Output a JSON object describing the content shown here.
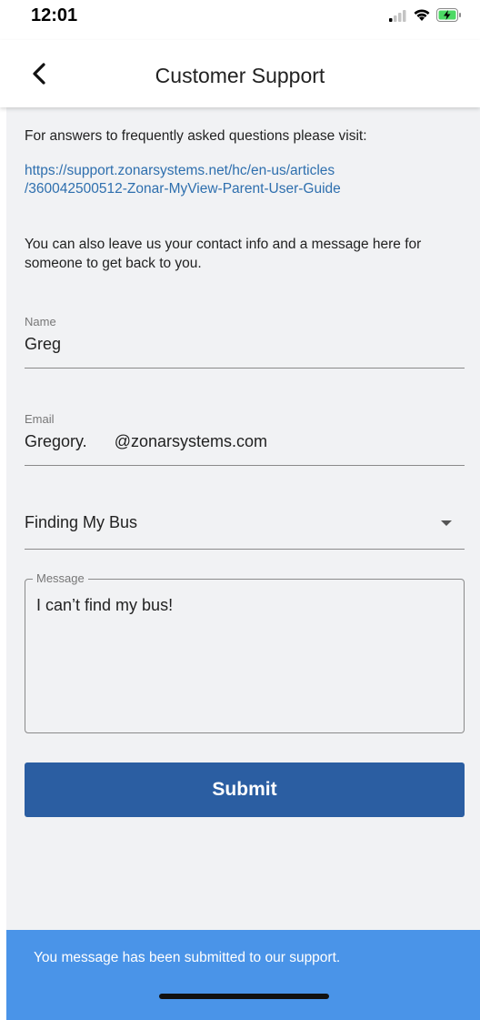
{
  "status_bar": {
    "time": "12:01",
    "icons": [
      "signal-icon",
      "wifi-icon",
      "battery-charging-icon"
    ],
    "battery_color": "#4cd964"
  },
  "header": {
    "title": "Customer Support",
    "back_icon": "chevron-left-icon"
  },
  "content": {
    "intro": "For answers to frequently asked questions please visit:",
    "link_line1": "https://support.zonarsystems.net/hc/en-us/articles",
    "link_line2": "/360042500512-Zonar-MyView-Parent-User-Guide",
    "also_line1": "You can also leave us your contact info and a message here for",
    "also_line2": "someone to get back to you."
  },
  "form": {
    "name_label": "Name",
    "name_value": "Greg",
    "email_label": "Email",
    "email_value": "Gregory.      @zonarsystems.com",
    "topic_value": "Finding My Bus",
    "message_label": "Message",
    "message_value": "I can’t find my bus!",
    "submit_label": "Submit"
  },
  "snackbar": {
    "text": "You message has been submitted to our support."
  },
  "colors": {
    "accent": "#2b5ea2",
    "link": "#2e6fae",
    "snackbar": "#4a94e8",
    "background": "#f1f2f4"
  }
}
